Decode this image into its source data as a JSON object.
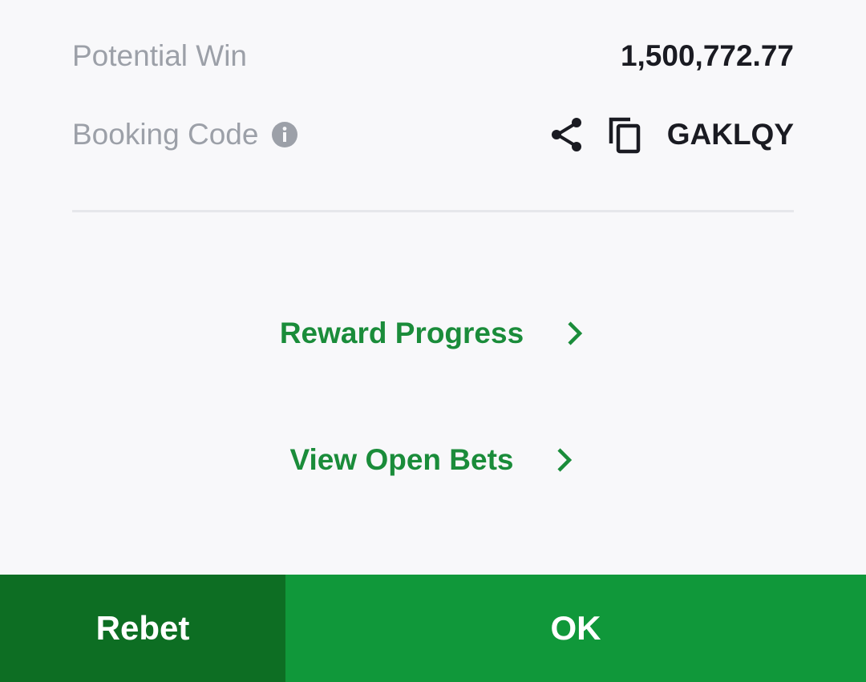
{
  "potential_win": {
    "label": "Potential Win",
    "value": "1,500,772.77"
  },
  "booking": {
    "label": "Booking Code",
    "code": "GAKLQY",
    "icons": [
      "info-icon",
      "share-icon",
      "copy-icon"
    ]
  },
  "links": {
    "reward_progress": "Reward Progress",
    "view_open_bets": "View Open Bets"
  },
  "buttons": {
    "rebet": "Rebet",
    "ok": "OK"
  },
  "colors": {
    "background": "#f8f8fa",
    "label_gray": "#9ca0a8",
    "text_dark": "#1a1b22",
    "link_green": "#1a8c3a",
    "rebet_green": "#0d6e23",
    "ok_green": "#10983a"
  }
}
